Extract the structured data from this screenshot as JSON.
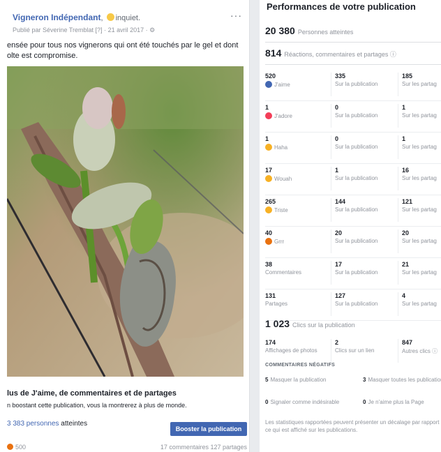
{
  "post": {
    "page_name": "Vigneron Indépendant",
    "feeling": "inquiet.",
    "meta": "Publié par Séverine Tremblat [?] · 21 avril 2017 · ⚙",
    "more": "···",
    "text": "ensée pour tous nos vignerons qui ont été touchés par le gel et dont olte est compromise.",
    "boost_title": "lus de J'aime, de commentaires et de partages",
    "boost_sub": "n boostant cette publication, vous la montrerez à plus de monde.",
    "reach_num": "3 383 personnes",
    "reach_label": "atteintes",
    "boost_button": "Booster la publication",
    "reactions_count": "500",
    "comments_shares": "17 commentaires  127 partages"
  },
  "perf": {
    "title": "Performances de votre publication",
    "reached_value": "20 380",
    "reached_label": "Personnes atteintes",
    "reactions_value": "814",
    "reactions_label": "Réactions, commentaires et partages ⓘ",
    "rows": [
      {
        "icon": "like-icon",
        "color": "#4267b2",
        "c0v": "520",
        "c0l": "J'aime",
        "c1v": "335",
        "c1l": "Sur la publication",
        "c2v": "185",
        "c2l": "Sur les partag"
      },
      {
        "icon": "love-icon",
        "color": "#f33e58",
        "c0v": "1",
        "c0l": "J'adore",
        "c1v": "0",
        "c1l": "Sur la publication",
        "c2v": "1",
        "c2l": "Sur les partag"
      },
      {
        "icon": "haha-icon",
        "color": "#f7b125",
        "c0v": "1",
        "c0l": "Haha",
        "c1v": "0",
        "c1l": "Sur la publication",
        "c2v": "1",
        "c2l": "Sur les partag"
      },
      {
        "icon": "wow-icon",
        "color": "#f7b125",
        "c0v": "17",
        "c0l": "Wouah",
        "c1v": "1",
        "c1l": "Sur la publication",
        "c2v": "16",
        "c2l": "Sur les partag"
      },
      {
        "icon": "sad-icon",
        "color": "#f7b125",
        "c0v": "265",
        "c0l": "Triste",
        "c1v": "144",
        "c1l": "Sur la publication",
        "c2v": "121",
        "c2l": "Sur les partag"
      },
      {
        "icon": "angry-icon",
        "color": "#e9710f",
        "c0v": "40",
        "c0l": "Grrr",
        "c1v": "20",
        "c1l": "Sur la publication",
        "c2v": "20",
        "c2l": "Sur les partag"
      },
      {
        "icon": "",
        "color": "",
        "c0v": "38",
        "c0l": "Commentaires",
        "c1v": "17",
        "c1l": "Sur la publication",
        "c2v": "21",
        "c2l": "Sur les partag"
      },
      {
        "icon": "",
        "color": "",
        "c0v": "131",
        "c0l": "Partages",
        "c1v": "127",
        "c1l": "Sur la publication",
        "c2v": "4",
        "c2l": "Sur les partag"
      }
    ],
    "clicks_value": "1 023",
    "clicks_label": "Clics sur la publication",
    "clicks": {
      "c0v": "174",
      "c0l": "Affichages de photos",
      "c1v": "2",
      "c1l": "Clics sur un lien",
      "c2v": "847",
      "c2l": "Autres clics ⓘ"
    },
    "neg_title": "COMMENTAIRES NÉGATIFS",
    "neg": [
      {
        "lv": "5",
        "l": "Masquer la publication",
        "rv": "3",
        "r": "Masquer toutes les publications"
      },
      {
        "lv": "0",
        "l": "Signaler comme indésirable",
        "rv": "0",
        "r": "Je n'aime plus la Page"
      }
    ],
    "disclaimer": "Les statistiques rapportées peuvent présenter un décalage par rapport à ce qui est affiché sur les publications."
  }
}
